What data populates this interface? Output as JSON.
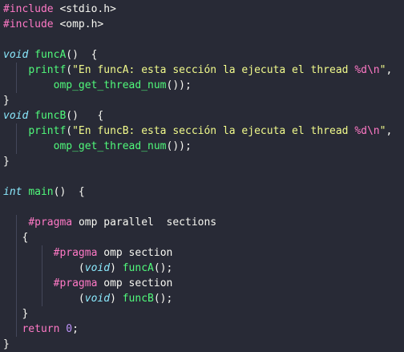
{
  "theme": {
    "background": "#282a36",
    "foreground": "#f8f8f2",
    "keyword": "#ff79c6",
    "type": "#8be9fd",
    "function": "#50fa7b",
    "string": "#f1fa8c",
    "number": "#bd93f9",
    "indent_guide": "#44475a"
  },
  "code": {
    "lines": [
      [
        {
          "t": "#include ",
          "c": "pre"
        },
        {
          "t": "<stdio.h>",
          "c": "plain"
        }
      ],
      [
        {
          "t": "#include ",
          "c": "pre"
        },
        {
          "t": "<omp.h>",
          "c": "plain"
        }
      ],
      [],
      [
        {
          "t": "void",
          "c": "type"
        },
        {
          "t": " ",
          "c": "plain"
        },
        {
          "t": "funcA",
          "c": "fn"
        },
        {
          "t": "()  {",
          "c": "plain"
        }
      ],
      [
        {
          "t": "    ",
          "c": "plain"
        },
        {
          "t": "printf",
          "c": "fn"
        },
        {
          "t": "(",
          "c": "plain"
        },
        {
          "t": "\"En funcA: esta sección la ejecuta el thread ",
          "c": "str"
        },
        {
          "t": "%d\\n",
          "c": "esc"
        },
        {
          "t": "\"",
          "c": "str"
        },
        {
          "t": ",",
          "c": "plain"
        }
      ],
      [
        {
          "t": "        ",
          "c": "plain"
        },
        {
          "t": "omp_get_thread_num",
          "c": "fn"
        },
        {
          "t": "());",
          "c": "plain"
        }
      ],
      [
        {
          "t": "}",
          "c": "plain"
        }
      ],
      [
        {
          "t": "void",
          "c": "type"
        },
        {
          "t": " ",
          "c": "plain"
        },
        {
          "t": "funcB",
          "c": "fn"
        },
        {
          "t": "()   {",
          "c": "plain"
        }
      ],
      [
        {
          "t": "    ",
          "c": "plain"
        },
        {
          "t": "printf",
          "c": "fn"
        },
        {
          "t": "(",
          "c": "plain"
        },
        {
          "t": "\"En funcB: esta sección la ejecuta el thread ",
          "c": "str"
        },
        {
          "t": "%d\\n",
          "c": "esc"
        },
        {
          "t": "\"",
          "c": "str"
        },
        {
          "t": ",",
          "c": "plain"
        }
      ],
      [
        {
          "t": "        ",
          "c": "plain"
        },
        {
          "t": "omp_get_thread_num",
          "c": "fn"
        },
        {
          "t": "());",
          "c": "plain"
        }
      ],
      [
        {
          "t": "}",
          "c": "plain"
        }
      ],
      [],
      [
        {
          "t": "int",
          "c": "type"
        },
        {
          "t": " ",
          "c": "plain"
        },
        {
          "t": "main",
          "c": "fn"
        },
        {
          "t": "()  {",
          "c": "plain"
        }
      ],
      [],
      [
        {
          "t": "    ",
          "c": "plain"
        },
        {
          "t": "#pragma ",
          "c": "pre"
        },
        {
          "t": "omp parallel  sections",
          "c": "plain"
        }
      ],
      [
        {
          "t": "   {",
          "c": "plain"
        }
      ],
      [
        {
          "t": "        ",
          "c": "plain"
        },
        {
          "t": "#pragma ",
          "c": "pre"
        },
        {
          "t": "omp section",
          "c": "plain"
        }
      ],
      [
        {
          "t": "            (",
          "c": "plain"
        },
        {
          "t": "void",
          "c": "type"
        },
        {
          "t": ") ",
          "c": "plain"
        },
        {
          "t": "funcA",
          "c": "fn"
        },
        {
          "t": "();",
          "c": "plain"
        }
      ],
      [
        {
          "t": "        ",
          "c": "plain"
        },
        {
          "t": "#pragma ",
          "c": "pre"
        },
        {
          "t": "omp section",
          "c": "plain"
        }
      ],
      [
        {
          "t": "            (",
          "c": "plain"
        },
        {
          "t": "void",
          "c": "type"
        },
        {
          "t": ") ",
          "c": "plain"
        },
        {
          "t": "funcB",
          "c": "fn"
        },
        {
          "t": "();",
          "c": "plain"
        }
      ],
      [
        {
          "t": "   }",
          "c": "plain"
        }
      ],
      [
        {
          "t": "   ",
          "c": "plain"
        },
        {
          "t": "return",
          "c": "kw"
        },
        {
          "t": " ",
          "c": "plain"
        },
        {
          "t": "0",
          "c": "num"
        },
        {
          "t": ";",
          "c": "plain"
        }
      ],
      [
        {
          "t": "}",
          "c": "plain"
        }
      ]
    ]
  }
}
